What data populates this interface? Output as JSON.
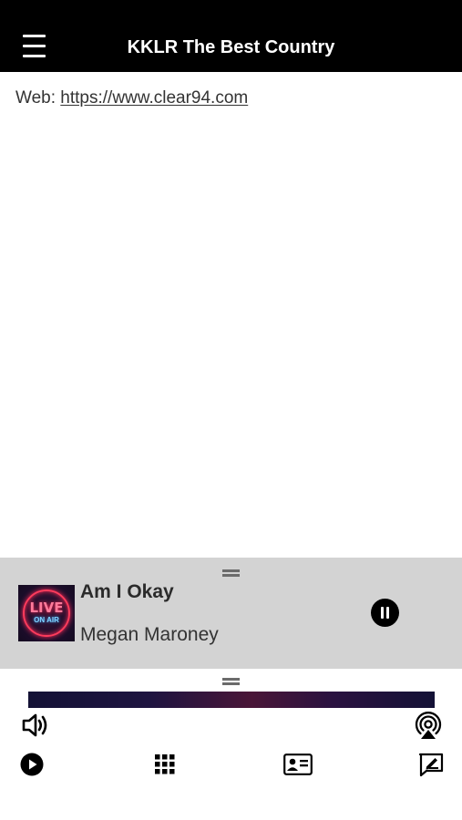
{
  "header": {
    "title": "KKLR The Best Country",
    "menu_icon": "hamburger-menu-icon"
  },
  "content": {
    "web_label": "Web:",
    "web_url": "https://www.clear94.com"
  },
  "now_playing": {
    "song_title": "Am I Okay",
    "artist": "Megan Maroney",
    "artwork_text_1": "LIVE",
    "artwork_text_2": "ON AIR",
    "state": "playing"
  },
  "bottom_bar": {
    "icons": [
      "volume-icon",
      "airplay-icon",
      "play-icon",
      "grid-icon",
      "contact-card-icon",
      "compose-icon"
    ]
  },
  "colors": {
    "header_bg": "#000000",
    "panel_bg": "#d3d3d3",
    "artwork_neon_red": "#ff3b5c"
  }
}
